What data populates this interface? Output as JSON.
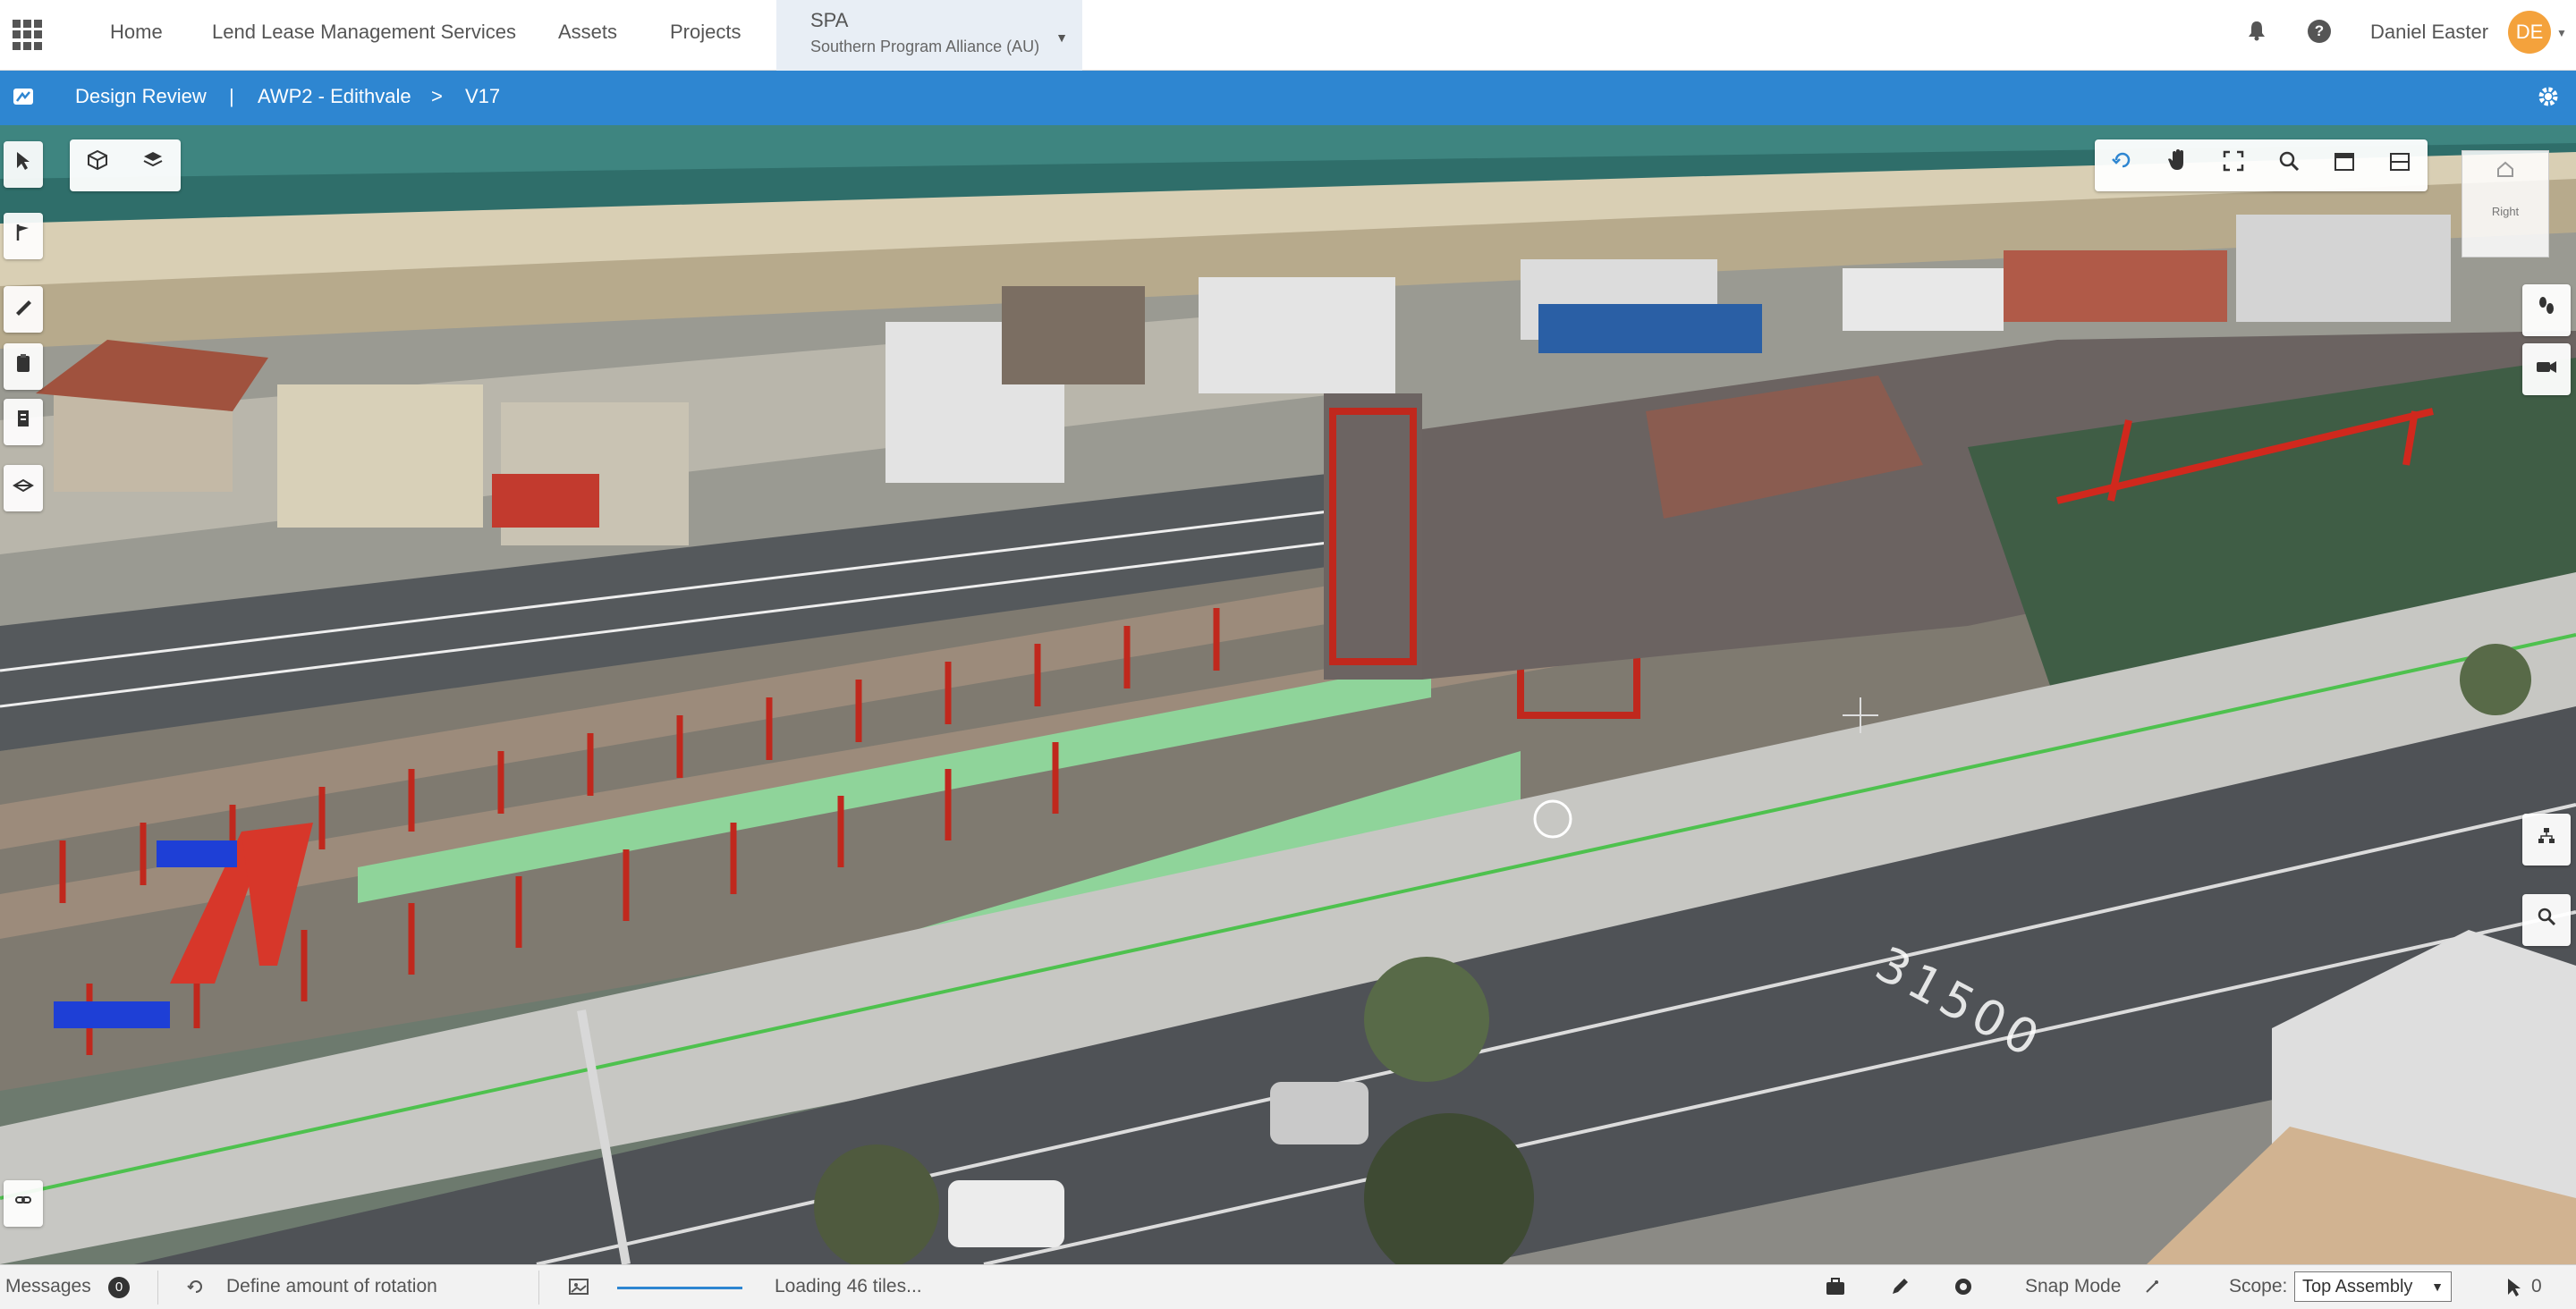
{
  "topbar": {
    "nav": [
      "Home",
      "Lend Lease Management Services",
      "Assets",
      "Projects"
    ],
    "project": {
      "code": "SPA",
      "name": "Southern Program Alliance (AU)"
    },
    "user": {
      "name": "Daniel Easter",
      "initials": "DE"
    },
    "icons": [
      "app-launcher-icon",
      "notification-bell-icon",
      "help-icon"
    ]
  },
  "breadcrumb": {
    "app": "Design Review",
    "separator": "|",
    "project": "AWP2 - Edithvale",
    "arrow": ">",
    "version": "V17"
  },
  "viewport": {
    "chainage_label": "31500",
    "view_cube_face": "Right"
  },
  "statusbar": {
    "messages_label": "Messages",
    "messages_count": "0",
    "tool_prompt": "Define amount of rotation",
    "loading_text": "Loading 46 tiles...",
    "snap_mode_label": "Snap Mode",
    "scope_label": "Scope:",
    "scope_value": "Top Assembly",
    "selection_count": "0"
  },
  "colors": {
    "accent": "#2e86d1",
    "avatar": "#f4a23c",
    "structure_red": "#c0281d",
    "barrier_green": "#8fd49a"
  }
}
